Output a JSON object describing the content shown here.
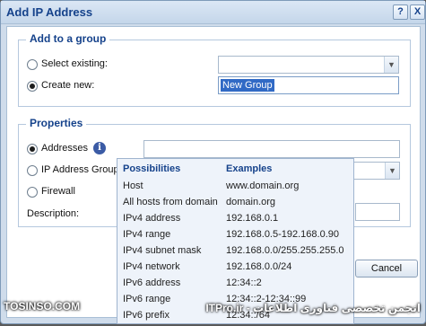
{
  "dialog": {
    "title": "Add IP Address",
    "help_button": "?",
    "close_button": "X"
  },
  "add_to_group": {
    "legend": "Add to a group",
    "select_existing_label": "Select existing:",
    "select_existing_value": "",
    "create_new_label": "Create new:",
    "create_new_value": "New Group",
    "selected_option": "create_new"
  },
  "properties": {
    "legend": "Properties",
    "addresses_label": "Addresses",
    "ip_group_label": "IP Address Group",
    "firewall_label": "Firewall",
    "description_label": "Description:",
    "selected_option": "addresses"
  },
  "possibilities_popup": {
    "col_possibilities": "Possibilities",
    "col_examples": "Examples",
    "rows": [
      {
        "possibility": "Host",
        "example": "www.domain.org"
      },
      {
        "possibility": "All hosts from domain",
        "example": "domain.org"
      },
      {
        "possibility": "IPv4 address",
        "example": "192.168.0.1"
      },
      {
        "possibility": "IPv4 range",
        "example": "192.168.0.5-192.168.0.90"
      },
      {
        "possibility": "IPv4 subnet mask",
        "example": "192.168.0.0/255.255.255.0"
      },
      {
        "possibility": "IPv4 network",
        "example": "192.168.0.0/24"
      },
      {
        "possibility": "IPv6 address",
        "example": "12:34::2"
      },
      {
        "possibility": "IPv6 range",
        "example": "12:34::2-12:34::99"
      },
      {
        "possibility": "IPv6 prefix",
        "example": "12:34::/64"
      }
    ]
  },
  "buttons": {
    "cancel": "Cancel"
  },
  "watermark": {
    "left": "TOSINSO.COM",
    "right": "انجمن تخصصی فناوری اطلاعات - ITPro.ir"
  },
  "colors": {
    "title_text": "#15428b",
    "selection": "#316ac5",
    "info_icon": "#3b5ba5"
  }
}
